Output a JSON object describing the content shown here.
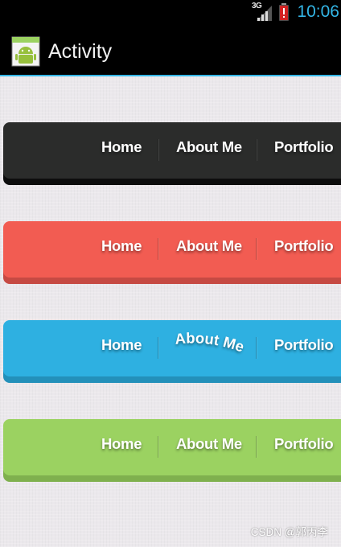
{
  "status_bar": {
    "network_type": "3G",
    "time": "10:06",
    "icons": [
      "signal-icon",
      "battery-alert-icon"
    ]
  },
  "action_bar": {
    "title": "Activity",
    "icon": "android-app-icon"
  },
  "nav_bars": [
    {
      "color": "#2b2c2b",
      "items": [
        "Home",
        "About Me",
        "Portfolio"
      ]
    },
    {
      "color": "#f25c52",
      "items": [
        "Home",
        "About Me",
        "Portfolio"
      ]
    },
    {
      "color": "#2eb0e1",
      "items": [
        "Home",
        "About Me",
        "Portfolio"
      ]
    },
    {
      "color": "#9bd261",
      "items": [
        "Home",
        "About Me",
        "Portfolio"
      ]
    }
  ],
  "watermark": "CSDN @郭丙李",
  "colors": {
    "accent": "#33b5e5",
    "background": "#ebe8ec"
  }
}
